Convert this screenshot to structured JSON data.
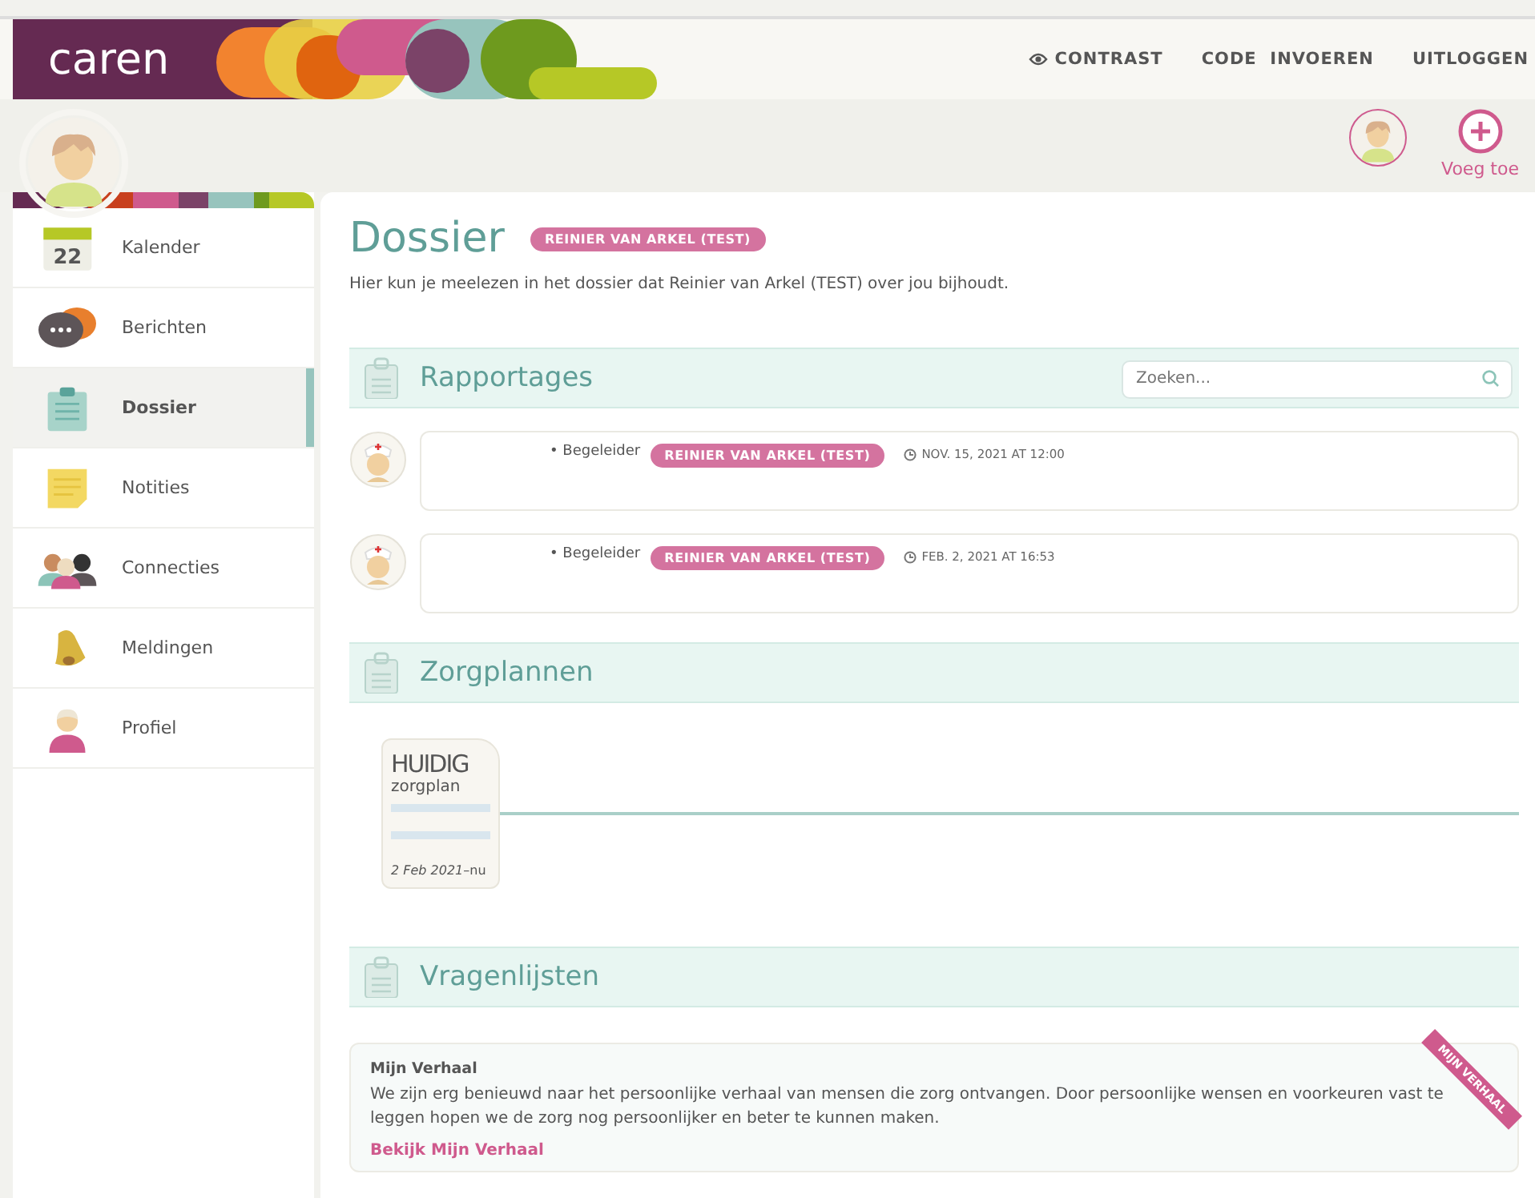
{
  "header": {
    "logo": "caren",
    "links": [
      {
        "label": "CONTRAST",
        "kind": "contrast"
      },
      {
        "label": "CODE  INVOEREN",
        "kind": "plain"
      },
      {
        "label": "UITLOGGEN",
        "kind": "plain"
      }
    ]
  },
  "profile_bar": {
    "add_label": "Voeg toe"
  },
  "sidebar": {
    "items": [
      {
        "label": "Kalender",
        "selected": false,
        "badge": "22"
      },
      {
        "label": "Berichten",
        "selected": false
      },
      {
        "label": "Dossier",
        "selected": true
      },
      {
        "label": "Notities",
        "selected": false
      },
      {
        "label": "Connecties",
        "selected": false
      },
      {
        "label": "Meldingen",
        "selected": false
      },
      {
        "label": "Profiel",
        "selected": false
      }
    ]
  },
  "page": {
    "title": "Dossier",
    "tag": "REINIER VAN ARKEL (TEST)",
    "intro": "Hier kun je meelezen in het dossier dat Reinier van Arkel (TEST) over jou bijhoudt."
  },
  "rapportages": {
    "title": "Rapportages",
    "search": {
      "placeholder": "Zoeken..."
    },
    "entries": [
      {
        "role": "• Begeleider",
        "author": "REINIER VAN ARKEL (TEST)",
        "date": "NOV. 15, 2021 AT 12:00"
      },
      {
        "role": "• Begeleider",
        "author": "REINIER VAN ARKEL (TEST)",
        "date": "FEB. 2, 2021 AT 16:53"
      }
    ]
  },
  "zorgplannen": {
    "title": "Zorgplannen",
    "plans": [
      {
        "status": "HUIDIG",
        "type": "zorgplan",
        "period": "*2 Feb 2021*–nu"
      }
    ]
  },
  "vragenlijsten": {
    "title": "Vragenlijsten",
    "cards": [
      {
        "title": "Mijn Verhaal",
        "text": "We zijn erg benieuwd naar het persoonlijke verhaal van mensen die zorg ontvangen. Door persoonlijke wensen en voorkeuren vast te leggen hopen we de zorg nog persoonlijker en beter te kunnen maken.",
        "link": "Bekijk Mijn Verhaal",
        "ribbon": "MIJN VERHAAL"
      }
    ]
  }
}
